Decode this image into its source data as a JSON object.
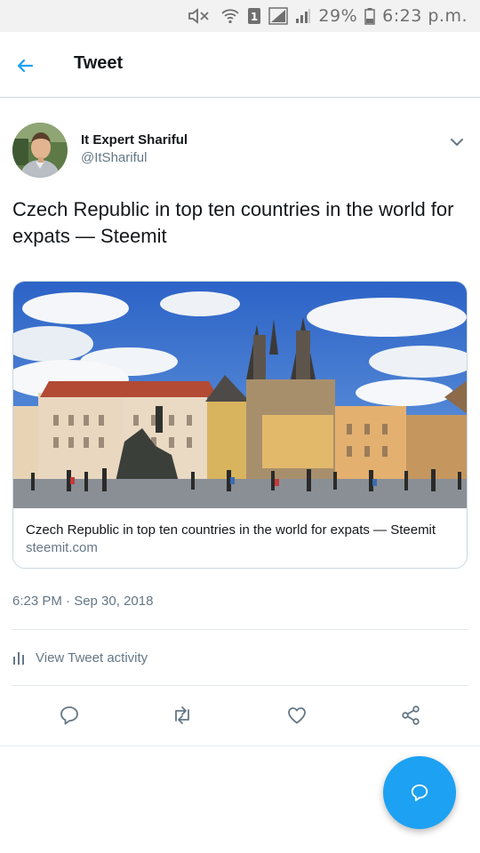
{
  "status_bar": {
    "battery": "29%",
    "time": "6:23 p.m."
  },
  "header": {
    "title": "Tweet"
  },
  "tweet": {
    "author_name": "It Expert Shariful",
    "author_handle": "@ItShariful",
    "text": "Czech Republic in top ten countries in the world for expats — Steemit",
    "card": {
      "title": "Czech Republic in top ten countries in the world for expats — Steemit",
      "domain": "steemit.com"
    },
    "timestamp": "6:23 PM · Sep 30, 2018",
    "activity_label": "View Tweet activity"
  },
  "colors": {
    "accent": "#1da1f2",
    "secondary_text": "#657786",
    "icon_gray": "#657786"
  },
  "icons": [
    "mute-icon",
    "wifi-icon",
    "sim-icon",
    "signal-icon",
    "battery-icon",
    "back-arrow-icon",
    "chevron-down-icon",
    "activity-bars-icon",
    "reply-icon",
    "retweet-icon",
    "like-icon",
    "share-icon",
    "compose-reply-icon"
  ]
}
